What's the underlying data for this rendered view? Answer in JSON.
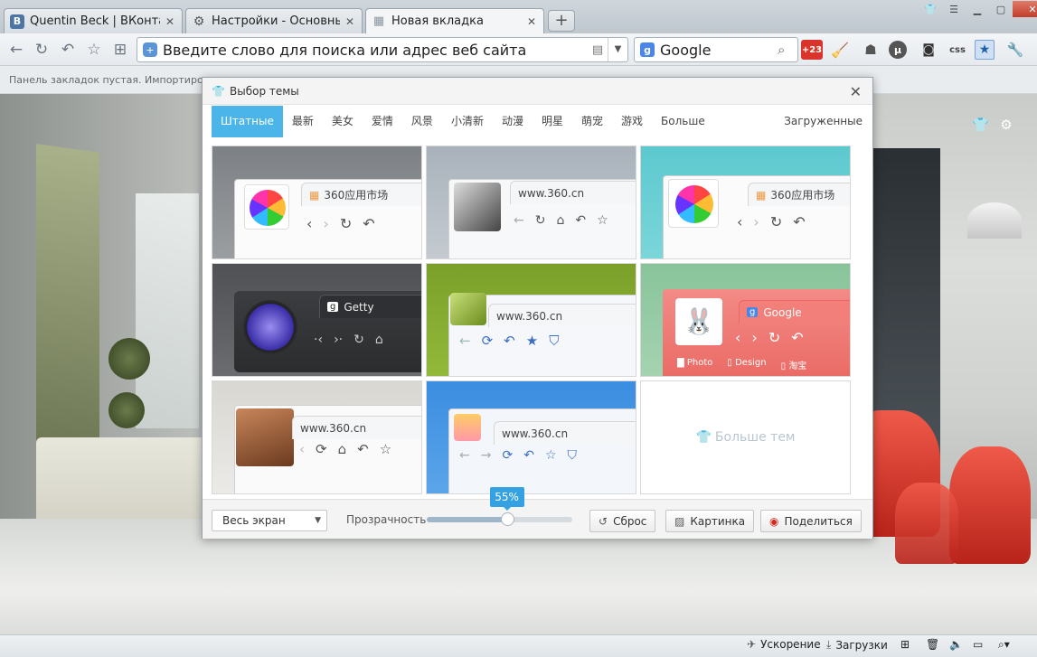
{
  "tabs": [
    {
      "label": "Quentin Beck | ВКонтакте",
      "icon": "vk-icon",
      "glyph": "В",
      "color": "#4c75a3"
    },
    {
      "label": "Настройки - Основные",
      "icon": "settings-gear-icon",
      "glyph": "⚙",
      "color": "#6d6d6d"
    },
    {
      "label": "Новая вкладка",
      "icon": "new-tab-grid-icon",
      "glyph": "▦",
      "color": "#9aa5b0"
    }
  ],
  "toolbar": {
    "address_placeholder": "Введите слово для поиска или адрес веб сайта",
    "search_engine": "Google",
    "badge_count": "+23",
    "css_label": "css"
  },
  "bookmarks_bar": {
    "text": "Панель закладок пустая.  Импортиров"
  },
  "dialog": {
    "title": "Выбор темы",
    "categories": [
      "Штатные",
      "最新",
      "美女",
      "爱情",
      "风景",
      "小清新",
      "动漫",
      "明星",
      "萌宠",
      "游戏",
      "Больше"
    ],
    "downloaded_label": "Загруженные",
    "themes": [
      {
        "url": "360应用市场"
      },
      {
        "url": "www.360.cn"
      },
      {
        "url": "360应用市场"
      },
      {
        "url": "Getty"
      },
      {
        "url": "www.360.cn"
      },
      {
        "url": "Google",
        "links": [
          "Photo",
          "Design",
          "淘宝"
        ]
      },
      {
        "url": "www.360.cn"
      },
      {
        "url": "www.360.cn"
      }
    ],
    "more_themes": "Больше тем",
    "bottom": {
      "fit_select": "Весь экран",
      "opacity_label": "Прозрачность",
      "opacity_value": "55%",
      "opacity": 0.55,
      "reset_btn": "Сброс",
      "picture_btn": "Картинка",
      "share_btn": "Поделиться"
    }
  },
  "status": {
    "accel": "Ускорение",
    "downloads": "Загрузки"
  }
}
